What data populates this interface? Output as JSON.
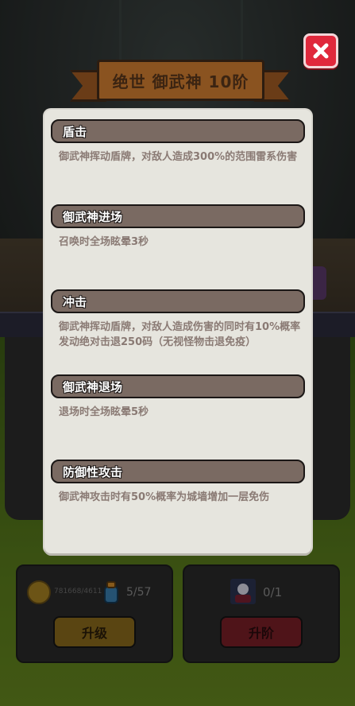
{
  "header": {
    "title": "绝世 御武神 10阶"
  },
  "close_button": {
    "icon": "close-icon"
  },
  "skills": [
    {
      "name": "盾击",
      "desc": "御武神挥动盾牌，对敌人造成300%的范围雷系伤害"
    },
    {
      "name": "御武神进场",
      "desc": "召唤时全场眩晕3秒"
    },
    {
      "name": "冲击",
      "desc": "御武神挥动盾牌，对敌人造成伤害的同时有10%概率发动绝对击退250码（无视怪物击退免疫）"
    },
    {
      "name": "御武神退场",
      "desc": "退场时全场眩晕5秒"
    },
    {
      "name": "防御性攻击",
      "desc": "御武神攻击时有50%概率为城墙增加一层免伤"
    }
  ],
  "bottom": {
    "coins": "781668/4611",
    "fragments": "5/57",
    "upgrade_label": "升级",
    "stage": "0/1",
    "advance_label": "升阶"
  },
  "colors": {
    "panel_bg": "#e6e5de",
    "skill_header_bg": "#7a6a62",
    "close_red": "#e0283c",
    "banner_brown": "#8a5320"
  }
}
